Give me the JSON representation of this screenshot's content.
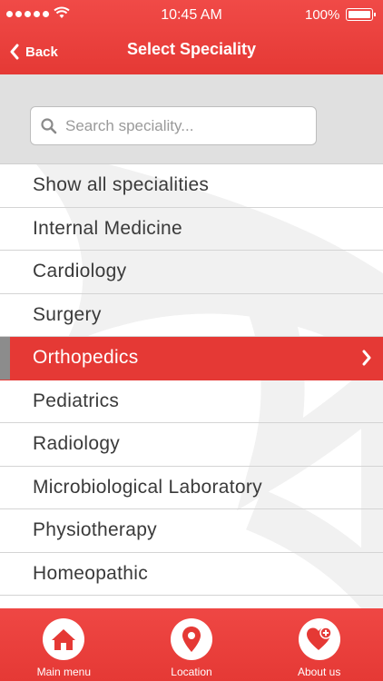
{
  "status_bar": {
    "time": "10:45 AM",
    "battery": "100%"
  },
  "nav": {
    "back_label": "Back",
    "title": "Select Speciality"
  },
  "search": {
    "placeholder": "Search speciality...",
    "value": ""
  },
  "specialities": [
    {
      "label": "Show all specialities"
    },
    {
      "label": "Internal Medicine"
    },
    {
      "label": "Cardiology"
    },
    {
      "label": "Surgery"
    },
    {
      "label": "Orthopedics",
      "selected": true
    },
    {
      "label": "Pediatrics"
    },
    {
      "label": "Radiology"
    },
    {
      "label": "Microbiological Laboratory"
    },
    {
      "label": "Physiotherapy"
    },
    {
      "label": "Homeopathic"
    }
  ],
  "tabbar": [
    {
      "label": "Main menu",
      "icon": "home-icon"
    },
    {
      "label": "Location",
      "icon": "location-pin-icon"
    },
    {
      "label": "About us",
      "icon": "heart-plus-icon"
    }
  ],
  "colors": {
    "accent": "#e53935",
    "search_band": "#e0e0e0",
    "selected_marker": "#8c8c8c"
  }
}
